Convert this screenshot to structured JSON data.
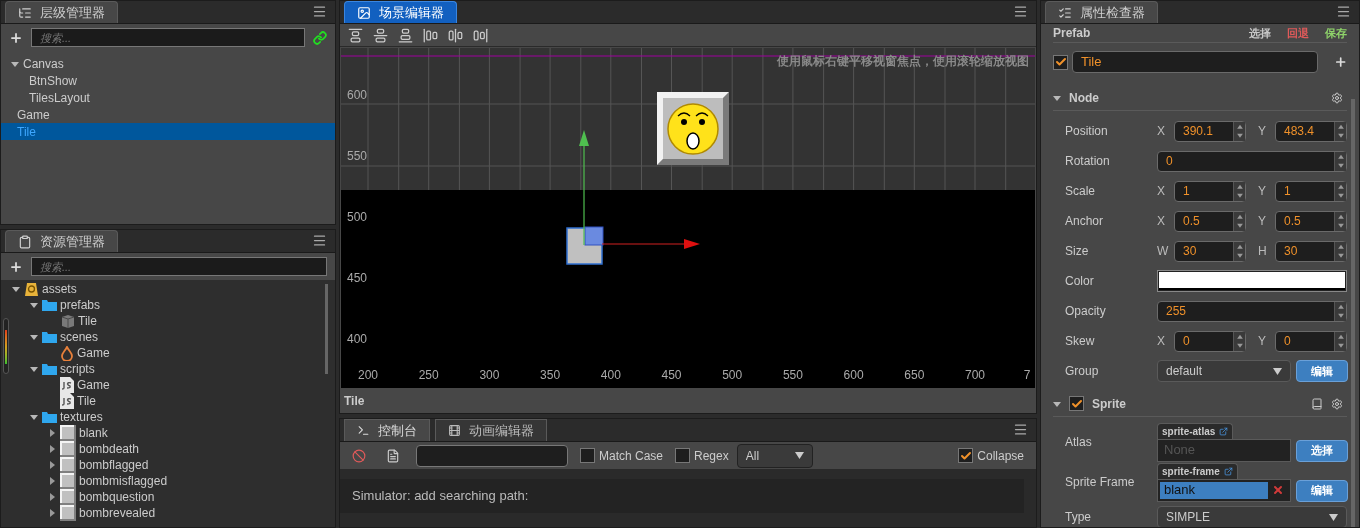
{
  "hierarchy": {
    "title": "层级管理器",
    "focused": false,
    "search_placeholder": "搜索...",
    "tree": [
      {
        "label": "Canvas",
        "selected": false,
        "expanded": true,
        "children": [
          {
            "label": "BtnShow",
            "selected": false
          },
          {
            "label": "TilesLayout",
            "selected": false
          }
        ]
      },
      {
        "label": "Game",
        "selected": false
      },
      {
        "label": "Tile",
        "selected": true
      }
    ]
  },
  "assets": {
    "title": "资源管理器",
    "focused": false,
    "search_placeholder": "搜索...",
    "tree": [
      {
        "label": "assets",
        "kind": "db",
        "expanded": true,
        "children": [
          {
            "label": "prefabs",
            "kind": "folder",
            "expanded": true,
            "children": [
              {
                "label": "Tile",
                "kind": "prefab"
              }
            ]
          },
          {
            "label": "scenes",
            "kind": "folder",
            "expanded": true,
            "children": [
              {
                "label": "Game",
                "kind": "scene"
              }
            ]
          },
          {
            "label": "scripts",
            "kind": "folder",
            "expanded": true,
            "children": [
              {
                "label": "Game",
                "kind": "script"
              },
              {
                "label": "Tile",
                "kind": "script"
              }
            ]
          },
          {
            "label": "textures",
            "kind": "folder",
            "expanded": true,
            "children": [
              {
                "label": "blank",
                "kind": "texture",
                "expanded": false
              },
              {
                "label": "bombdeath",
                "kind": "texture",
                "expanded": false
              },
              {
                "label": "bombflagged",
                "kind": "texture",
                "expanded": false
              },
              {
                "label": "bombmisflagged",
                "kind": "texture",
                "expanded": false
              },
              {
                "label": "bombquestion",
                "kind": "texture",
                "expanded": false
              },
              {
                "label": "bombrevealed",
                "kind": "texture",
                "expanded": false
              }
            ]
          }
        ]
      }
    ]
  },
  "scene": {
    "title": "场景编辑器",
    "focused": true,
    "hint": "使用鼠标右键平移视窗焦点，使用滚轮缩放视图",
    "y_ruler": [
      "600",
      "550",
      "500",
      "450",
      "400"
    ],
    "x_ruler": [
      "200",
      "250",
      "300",
      "350",
      "400",
      "450",
      "500",
      "550",
      "600",
      "650",
      "700",
      "7"
    ],
    "node_label": "Tile"
  },
  "console": {
    "tabs": [
      {
        "label": "控制台",
        "kind": "console",
        "selected": true
      },
      {
        "label": "动画编辑器",
        "kind": "animation",
        "selected": false
      }
    ],
    "match_case": {
      "label": "Match Case",
      "checked": false
    },
    "regex": {
      "label": "Regex",
      "checked": false
    },
    "level": "All",
    "collapse": {
      "label": "Collapse",
      "checked": true
    },
    "messages": [
      "Simulator: add searching path:"
    ]
  },
  "inspector": {
    "title": "属性检查器",
    "focused": false,
    "prefab": {
      "label": "Prefab",
      "actions": [
        {
          "label": "选择",
          "color": "#c8c8c8"
        },
        {
          "label": "回退",
          "color": "#e05a5a"
        },
        {
          "label": "保存",
          "color": "#8fd46a"
        }
      ]
    },
    "node": {
      "enabled": true,
      "name": "Tile"
    },
    "sections": [
      {
        "title": "Node",
        "expanded": true,
        "props": [
          {
            "kind": "vec",
            "label": "Position",
            "fields": [
              {
                "axis": "X",
                "value": "390.1"
              },
              {
                "axis": "Y",
                "value": "483.4"
              }
            ]
          },
          {
            "kind": "number",
            "label": "Rotation",
            "value": "0"
          },
          {
            "kind": "vec",
            "label": "Scale",
            "fields": [
              {
                "axis": "X",
                "value": "1"
              },
              {
                "axis": "Y",
                "value": "1"
              }
            ]
          },
          {
            "kind": "vec",
            "label": "Anchor",
            "fields": [
              {
                "axis": "X",
                "value": "0.5"
              },
              {
                "axis": "Y",
                "value": "0.5"
              }
            ]
          },
          {
            "kind": "vec",
            "label": "Size",
            "fields": [
              {
                "axis": "W",
                "value": "30"
              },
              {
                "axis": "H",
                "value": "30"
              }
            ]
          },
          {
            "kind": "color",
            "label": "Color",
            "color": "#ffffff"
          },
          {
            "kind": "number",
            "label": "Opacity",
            "value": "255"
          },
          {
            "kind": "vec",
            "label": "Skew",
            "fields": [
              {
                "axis": "X",
                "value": "0"
              },
              {
                "axis": "Y",
                "value": "0"
              }
            ]
          },
          {
            "kind": "select",
            "label": "Group",
            "value": "default",
            "button": "编辑"
          }
        ]
      },
      {
        "title": "Sprite",
        "expanded": true,
        "enabled": true,
        "props": [
          {
            "kind": "asset",
            "label": "Atlas",
            "type": "sprite-atlas",
            "placeholder": "None",
            "button": "选择"
          },
          {
            "kind": "asset",
            "label": "Sprite Frame",
            "type": "sprite-frame",
            "value": "blank",
            "button": "编辑"
          },
          {
            "kind": "select",
            "label": "Type",
            "value": "SIMPLE"
          }
        ]
      }
    ]
  }
}
